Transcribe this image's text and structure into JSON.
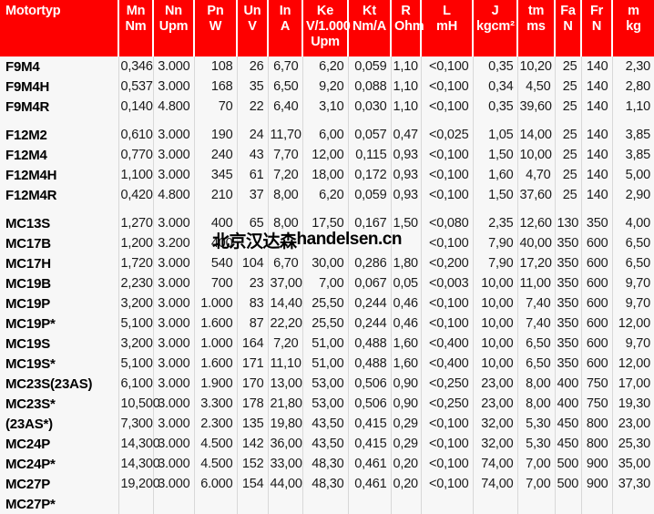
{
  "table": {
    "columns": [
      {
        "key": "name",
        "line1": "Motortyp",
        "line2": "",
        "line3": ""
      },
      {
        "key": "mn",
        "line1": "Mn",
        "line2": "Nm",
        "line3": ""
      },
      {
        "key": "nn",
        "line1": "Nn",
        "line2": "Upm",
        "line3": ""
      },
      {
        "key": "pn",
        "line1": "Pn",
        "line2": "W",
        "line3": ""
      },
      {
        "key": "un",
        "line1": "Un",
        "line2": "V",
        "line3": ""
      },
      {
        "key": "in",
        "line1": "In",
        "line2": "A",
        "line3": ""
      },
      {
        "key": "ke",
        "line1": "Ke",
        "line2": "V/1.000",
        "line3": "Upm"
      },
      {
        "key": "kt",
        "line1": "Kt",
        "line2": "Nm/A",
        "line3": ""
      },
      {
        "key": "r",
        "line1": "R",
        "line2": "Ohm",
        "line3": ""
      },
      {
        "key": "l",
        "line1": "L",
        "line2": "mH",
        "line3": ""
      },
      {
        "key": "j",
        "line1": "J",
        "line2": "kgcm²",
        "line3": ""
      },
      {
        "key": "tm",
        "line1": "tm",
        "line2": "ms",
        "line3": ""
      },
      {
        "key": "fa",
        "line1": "Fa",
        "line2": "N",
        "line3": ""
      },
      {
        "key": "fr",
        "line1": "Fr",
        "line2": "N",
        "line3": ""
      },
      {
        "key": "m",
        "line1": "m",
        "line2": "kg",
        "line3": ""
      }
    ],
    "groups": [
      {
        "rows": [
          {
            "name": "F9M4",
            "mn": "0,346",
            "nn": "3.000",
            "pn": "108",
            "un": "26",
            "in": "6,70",
            "ke": "6,20",
            "kt": "0,059",
            "r": "1,10",
            "l": "<0,100",
            "j": "0,35",
            "tm": "10,20",
            "fa": "25",
            "fr": "140",
            "m": "2,30"
          },
          {
            "name": "F9M4H",
            "mn": "0,537",
            "nn": "3.000",
            "pn": "168",
            "un": "35",
            "in": "6,50",
            "ke": "9,20",
            "kt": "0,088",
            "r": "1,10",
            "l": "<0,100",
            "j": "0,34",
            "tm": "4,50",
            "fa": "25",
            "fr": "140",
            "m": "2,80"
          },
          {
            "name": "F9M4R",
            "mn": "0,140",
            "nn": "4.800",
            "pn": "70",
            "un": "22",
            "in": "6,40",
            "ke": "3,10",
            "kt": "0,030",
            "r": "1,10",
            "l": "<0,100",
            "j": "0,35",
            "tm": "39,60",
            "fa": "25",
            "fr": "140",
            "m": "1,10"
          }
        ]
      },
      {
        "rows": [
          {
            "name": "F12M2",
            "mn": "0,610",
            "nn": "3.000",
            "pn": "190",
            "un": "24",
            "in": "11,70",
            "ke": "6,00",
            "kt": "0,057",
            "r": "0,47",
            "l": "<0,025",
            "j": "1,05",
            "tm": "14,00",
            "fa": "25",
            "fr": "140",
            "m": "3,85"
          },
          {
            "name": "F12M4",
            "mn": "0,770",
            "nn": "3.000",
            "pn": "240",
            "un": "43",
            "in": "7,70",
            "ke": "12,00",
            "kt": "0,115",
            "r": "0,93",
            "l": "<0,100",
            "j": "1,50",
            "tm": "10,00",
            "fa": "25",
            "fr": "140",
            "m": "3,85"
          },
          {
            "name": "F12M4H",
            "mn": "1,100",
            "nn": "3.000",
            "pn": "345",
            "un": "61",
            "in": "7,20",
            "ke": "18,00",
            "kt": "0,172",
            "r": "0,93",
            "l": "<0,100",
            "j": "1,60",
            "tm": "4,70",
            "fa": "25",
            "fr": "140",
            "m": "5,00"
          },
          {
            "name": "F12M4R",
            "mn": "0,420",
            "nn": "4.800",
            "pn": "210",
            "un": "37",
            "in": "8,00",
            "ke": "6,20",
            "kt": "0,059",
            "r": "0,93",
            "l": "<0,100",
            "j": "1,50",
            "tm": "37,60",
            "fa": "25",
            "fr": "140",
            "m": "2,90"
          }
        ]
      },
      {
        "rows": [
          {
            "name": "MC13S",
            "mn": "1,270",
            "nn": "3.000",
            "pn": "400",
            "un": "65",
            "in": "8,00",
            "ke": "17,50",
            "kt": "0,167",
            "r": "1,50",
            "l": "<0,080",
            "j": "2,35",
            "tm": "12,60",
            "fa": "130",
            "fr": "350",
            "m": "4,00"
          },
          {
            "name": "MC17B",
            "mn": "1,200",
            "nn": "3.200",
            "pn": "400",
            "un": "",
            "in": "",
            "ke": "",
            "kt": "",
            "r": "",
            "l": "<0,100",
            "j": "7,90",
            "tm": "40,00",
            "fa": "350",
            "fr": "600",
            "m": "6,50"
          },
          {
            "name": "MC17H",
            "mn": "1,720",
            "nn": "3.000",
            "pn": "540",
            "un": "104",
            "in": "6,70",
            "ke": "30,00",
            "kt": "0,286",
            "r": "1,80",
            "l": "<0,200",
            "j": "7,90",
            "tm": "17,20",
            "fa": "350",
            "fr": "600",
            "m": "6,50"
          },
          {
            "name": "MC19B",
            "mn": "2,230",
            "nn": "3.000",
            "pn": "700",
            "un": "23",
            "in": "37,00",
            "ke": "7,00",
            "kt": "0,067",
            "r": "0,05",
            "l": "<0,003",
            "j": "10,00",
            "tm": "11,00",
            "fa": "350",
            "fr": "600",
            "m": "9,70"
          },
          {
            "name": "MC19P",
            "mn": "3,200",
            "nn": "3.000",
            "pn": "1.000",
            "un": "83",
            "in": "14,40",
            "ke": "25,50",
            "kt": "0,244",
            "r": "0,46",
            "l": "<0,100",
            "j": "10,00",
            "tm": "7,40",
            "fa": "350",
            "fr": "600",
            "m": "9,70"
          },
          {
            "name": "MC19P*",
            "mn": "5,100",
            "nn": "3.000",
            "pn": "1.600",
            "un": "87",
            "in": "22,20",
            "ke": "25,50",
            "kt": "0,244",
            "r": "0,46",
            "l": "<0,100",
            "j": "10,00",
            "tm": "7,40",
            "fa": "350",
            "fr": "600",
            "m": "12,00"
          },
          {
            "name": "MC19S",
            "mn": "3,200",
            "nn": "3.000",
            "pn": "1.000",
            "un": "164",
            "in": "7,20",
            "ke": "51,00",
            "kt": "0,488",
            "r": "1,60",
            "l": "<0,400",
            "j": "10,00",
            "tm": "6,50",
            "fa": "350",
            "fr": "600",
            "m": "9,70"
          },
          {
            "name": "MC19S*",
            "mn": "5,100",
            "nn": "3.000",
            "pn": "1.600",
            "un": "171",
            "in": "11,10",
            "ke": "51,00",
            "kt": "0,488",
            "r": "1,60",
            "l": "<0,400",
            "j": "10,00",
            "tm": "6,50",
            "fa": "350",
            "fr": "600",
            "m": "12,00"
          },
          {
            "name": "MC23S(23AS)",
            "mn": "6,100",
            "nn": "3.000",
            "pn": "1.900",
            "un": "170",
            "in": "13,00",
            "ke": "53,00",
            "kt": "0,506",
            "r": "0,90",
            "l": "<0,250",
            "j": "23,00",
            "tm": "8,00",
            "fa": "400",
            "fr": "750",
            "m": "17,00"
          },
          {
            "name": "MC23S*",
            "mn": "10,500",
            "nn": "3.000",
            "pn": "3.300",
            "un": "178",
            "in": "21,80",
            "ke": "53,00",
            "kt": "0,506",
            "r": "0,90",
            "l": "<0,250",
            "j": "23,00",
            "tm": "8,00",
            "fa": "400",
            "fr": "750",
            "m": "19,30"
          },
          {
            "name": "(23AS*)",
            "mn": "7,300",
            "nn": "3.000",
            "pn": "2.300",
            "un": "135",
            "in": "19,80",
            "ke": "43,50",
            "kt": "0,415",
            "r": "0,29",
            "l": "<0,100",
            "j": "32,00",
            "tm": "5,30",
            "fa": "450",
            "fr": "800",
            "m": "23,00"
          },
          {
            "name": "MC24P",
            "mn": "14,300",
            "nn": "3.000",
            "pn": "4.500",
            "un": "142",
            "in": "36,00",
            "ke": "43,50",
            "kt": "0,415",
            "r": "0,29",
            "l": "<0,100",
            "j": "32,00",
            "tm": "5,30",
            "fa": "450",
            "fr": "800",
            "m": "25,30"
          },
          {
            "name": "MC24P*",
            "mn": "14,300",
            "nn": "3.000",
            "pn": "4.500",
            "un": "152",
            "in": "33,00",
            "ke": "48,30",
            "kt": "0,461",
            "r": "0,20",
            "l": "<0,100",
            "j": "74,00",
            "tm": "7,00",
            "fa": "500",
            "fr": "900",
            "m": "35,00"
          },
          {
            "name": "MC27P",
            "mn": "19,200",
            "nn": "3.000",
            "pn": "6.000",
            "un": "154",
            "in": "44,00",
            "ke": "48,30",
            "kt": "0,461",
            "r": "0,20",
            "l": "<0,100",
            "j": "74,00",
            "tm": "7,00",
            "fa": "500",
            "fr": "900",
            "m": "37,30"
          },
          {
            "name": "MC27P*",
            "mn": "",
            "nn": "",
            "pn": "",
            "un": "",
            "in": "",
            "ke": "",
            "kt": "",
            "r": "",
            "l": "",
            "j": "",
            "tm": "",
            "fa": "",
            "fr": "",
            "m": ""
          }
        ]
      }
    ]
  },
  "watermark": {
    "chinese": "北京汉达森",
    "latin": "handelsen.cn"
  },
  "colors": {
    "header_background": "#fe0000",
    "header_text": "#ffffff",
    "body_background": "#f7f7f7",
    "body_text": "#1a1a1a",
    "grid_line": "#d8d8d8"
  }
}
